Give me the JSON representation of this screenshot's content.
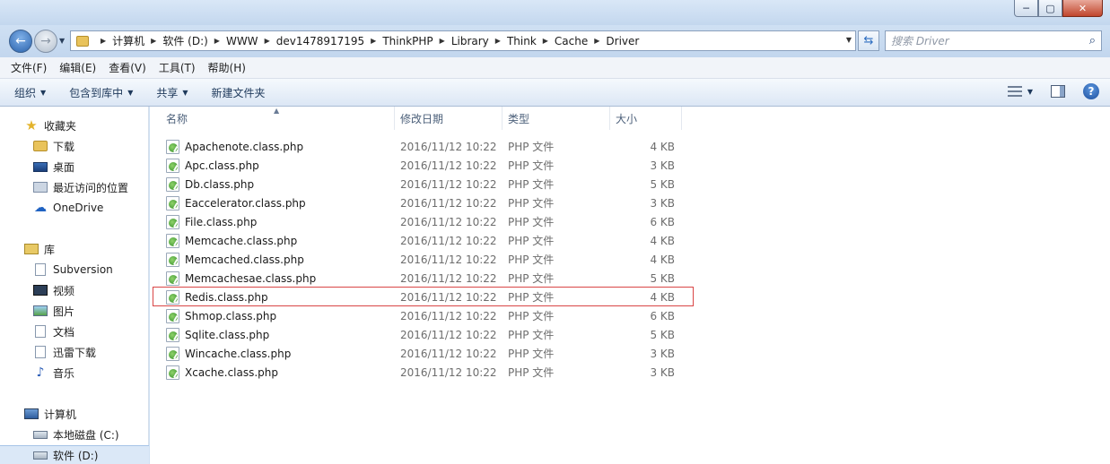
{
  "window": {
    "minimize_glyph": "─",
    "maximize_glyph": "▢",
    "close_glyph": "✕"
  },
  "address": {
    "breadcrumbs": [
      "计算机",
      "软件 (D:)",
      "WWW",
      "dev1478917195",
      "ThinkPHP",
      "Library",
      "Think",
      "Cache",
      "Driver"
    ],
    "search_placeholder": "搜索 Driver"
  },
  "menu": [
    "文件(F)",
    "编辑(E)",
    "查看(V)",
    "工具(T)",
    "帮助(H)"
  ],
  "toolbar": {
    "organize": "组织",
    "include_library": "包含到库中",
    "share": "共享",
    "new_folder": "新建文件夹"
  },
  "sidebar": {
    "favorites": [
      {
        "label": "收藏夹",
        "icon": "star-icon"
      },
      {
        "label": "下载",
        "icon": "downloads-icon"
      },
      {
        "label": "桌面",
        "icon": "desktop-icon"
      },
      {
        "label": "最近访问的位置",
        "icon": "recent-places-icon"
      },
      {
        "label": "OneDrive",
        "icon": "onedrive-icon"
      }
    ],
    "libraries": [
      {
        "label": "库",
        "icon": "libraries-icon"
      },
      {
        "label": "Subversion",
        "icon": "document-icon"
      },
      {
        "label": "视频",
        "icon": "video-icon"
      },
      {
        "label": "图片",
        "icon": "pictures-icon"
      },
      {
        "label": "文档",
        "icon": "documents-icon"
      },
      {
        "label": "迅雷下载",
        "icon": "thunder-download-icon"
      },
      {
        "label": "音乐",
        "icon": "music-icon"
      }
    ],
    "computer": [
      {
        "label": "计算机",
        "icon": "computer-icon"
      },
      {
        "label": "本地磁盘 (C:)",
        "icon": "drive-icon"
      },
      {
        "label": "软件 (D:)",
        "icon": "drive-icon"
      }
    ]
  },
  "columns": {
    "name": "名称",
    "date": "修改日期",
    "type": "类型",
    "size": "大小"
  },
  "files": [
    {
      "name": "Apachenote.class.php",
      "date": "2016/11/12 10:22",
      "type": "PHP 文件",
      "size": "4 KB"
    },
    {
      "name": "Apc.class.php",
      "date": "2016/11/12 10:22",
      "type": "PHP 文件",
      "size": "3 KB"
    },
    {
      "name": "Db.class.php",
      "date": "2016/11/12 10:22",
      "type": "PHP 文件",
      "size": "5 KB"
    },
    {
      "name": "Eaccelerator.class.php",
      "date": "2016/11/12 10:22",
      "type": "PHP 文件",
      "size": "3 KB"
    },
    {
      "name": "File.class.php",
      "date": "2016/11/12 10:22",
      "type": "PHP 文件",
      "size": "6 KB"
    },
    {
      "name": "Memcache.class.php",
      "date": "2016/11/12 10:22",
      "type": "PHP 文件",
      "size": "4 KB"
    },
    {
      "name": "Memcached.class.php",
      "date": "2016/11/12 10:22",
      "type": "PHP 文件",
      "size": "4 KB"
    },
    {
      "name": "Memcachesae.class.php",
      "date": "2016/11/12 10:22",
      "type": "PHP 文件",
      "size": "5 KB"
    },
    {
      "name": "Redis.class.php",
      "date": "2016/11/12 10:22",
      "type": "PHP 文件",
      "size": "4 KB"
    },
    {
      "name": "Shmop.class.php",
      "date": "2016/11/12 10:22",
      "type": "PHP 文件",
      "size": "6 KB"
    },
    {
      "name": "Sqlite.class.php",
      "date": "2016/11/12 10:22",
      "type": "PHP 文件",
      "size": "5 KB"
    },
    {
      "name": "Wincache.class.php",
      "date": "2016/11/12 10:22",
      "type": "PHP 文件",
      "size": "3 KB"
    },
    {
      "name": "Xcache.class.php",
      "date": "2016/11/12 10:22",
      "type": "PHP 文件",
      "size": "3 KB"
    }
  ],
  "colors": {
    "highlight_border": "#d94545"
  }
}
